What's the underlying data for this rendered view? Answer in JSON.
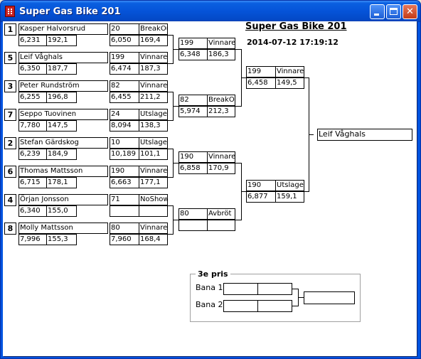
{
  "window": {
    "title": "Super Gas Bike 201"
  },
  "header": {
    "title": "Super Gas Bike 201",
    "datetime": "2014-07-12 17:19:12"
  },
  "round1": [
    {
      "seed": "1",
      "name": "Kasper Halvorsrud",
      "rt": "6,231",
      "speed": "192,1",
      "bike": "20",
      "result": "BreakOut",
      "et": "6,050",
      "mph": "169,4"
    },
    {
      "seed": "5",
      "name": "Leif Våghals",
      "rt": "6,350",
      "speed": "187,7",
      "bike": "199",
      "result": "Vinnare",
      "et": "6,474",
      "mph": "187,3"
    },
    {
      "seed": "3",
      "name": "Peter Rundström",
      "rt": "6,255",
      "speed": "196,8",
      "bike": "82",
      "result": "Vinnare",
      "et": "6,455",
      "mph": "211,2"
    },
    {
      "seed": "7",
      "name": "Seppo Tuovinen",
      "rt": "7,780",
      "speed": "147,5",
      "bike": "24",
      "result": "Utslagen",
      "et": "8,094",
      "mph": "138,3"
    },
    {
      "seed": "2",
      "name": "Stefan Gärdskog",
      "rt": "6,239",
      "speed": "184,9",
      "bike": "10",
      "result": "Utslagen",
      "et": "10,189",
      "mph": "101,1"
    },
    {
      "seed": "6",
      "name": "Thomas Mattsson",
      "rt": "6,715",
      "speed": "178,1",
      "bike": "190",
      "result": "Vinnare",
      "et": "6,663",
      "mph": "177,1"
    },
    {
      "seed": "4",
      "name": "Örjan Jonsson",
      "rt": "6,340",
      "speed": "155,0",
      "bike": "71",
      "result": "NoShow",
      "et": "",
      "mph": ""
    },
    {
      "seed": "8",
      "name": "Molly Mattsson",
      "rt": "7,996",
      "speed": "155,3",
      "bike": "80",
      "result": "Vinnare",
      "et": "7,960",
      "mph": "168,4"
    }
  ],
  "round2": [
    {
      "bike": "199",
      "result": "Vinnare",
      "et": "6,348",
      "mph": "186,3"
    },
    {
      "bike": "82",
      "result": "BreakOut",
      "et": "5,974",
      "mph": "212,3"
    },
    {
      "bike": "190",
      "result": "Vinnare",
      "et": "6,858",
      "mph": "170,9"
    },
    {
      "bike": "80",
      "result": "Avbröt",
      "et": "",
      "mph": ""
    }
  ],
  "round3": [
    {
      "bike": "199",
      "result": "Vinnare",
      "et": "6,458",
      "mph": "149,5"
    },
    {
      "bike": "190",
      "result": "Utslagen",
      "et": "6,877",
      "mph": "159,1"
    }
  ],
  "winner": "Leif Våghals",
  "third_place": {
    "title": "3e pris",
    "lane1_label": "Bana 1",
    "lane2_label": "Bana 2",
    "lane1_a": "",
    "lane1_b": "",
    "lane2_a": "",
    "lane2_b": "",
    "result": ""
  }
}
